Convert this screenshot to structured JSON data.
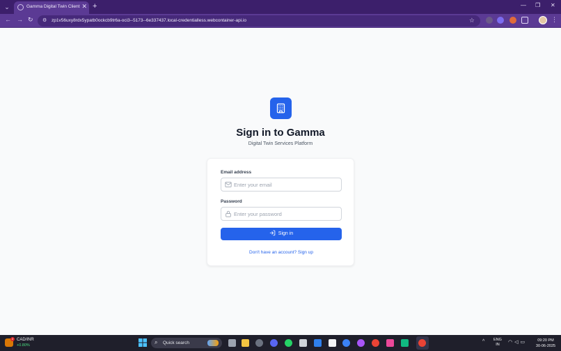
{
  "browser": {
    "tab_title": "Gamma Digital Twin Client Onb",
    "url": "zp1v56uxy8rdx5ypatb0ockcb9tr6a-oci3--5173--6e337437.local-credentialless.webcontainer-api.io",
    "tab_close": "✕",
    "new_tab": "+",
    "minimize": "—",
    "restore": "❐",
    "close": "✕",
    "back": "←",
    "forward": "→",
    "reload": "↻",
    "star": "☆",
    "menu": "⋮"
  },
  "page": {
    "title": "Sign in to Gamma",
    "subtitle": "Digital Twin Services Platform",
    "form": {
      "email_label": "Email address",
      "email_placeholder": "Enter your email",
      "email_value": "",
      "password_label": "Password",
      "password_placeholder": "Enter your password",
      "password_value": "",
      "submit_label": "Sign in",
      "signup_link": "Don't have an account? Sign up"
    }
  },
  "taskbar": {
    "ticker_name": "CAD/INR",
    "ticker_change": "+0.80%",
    "weather_badge": "2",
    "search_label": "Quick search",
    "lang_line1": "ENG",
    "lang_line2": "IN",
    "time": "09:20 PM",
    "date": "30-06-2025",
    "tray_caret": "^"
  },
  "colors": {
    "accent": "#2563eb",
    "browser_frame": "#3c1f6b",
    "taskbar": "#1f1f2b"
  },
  "icons": {
    "logo": "building-icon",
    "email": "mail-icon",
    "password": "lock-icon",
    "submit": "log-in-icon"
  }
}
